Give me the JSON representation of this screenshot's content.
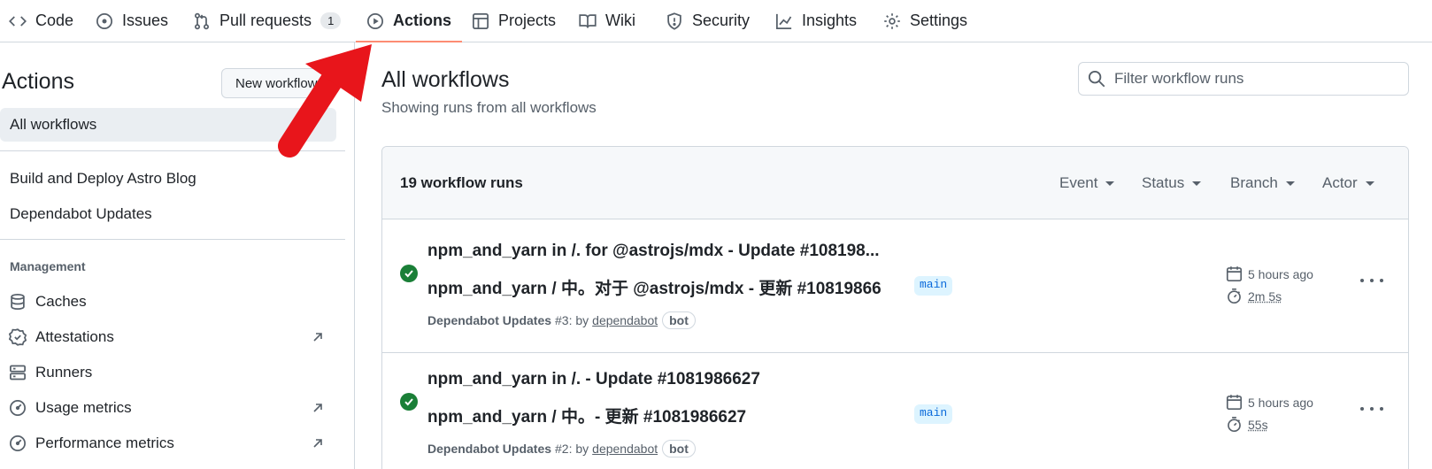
{
  "nav": {
    "tabs": [
      {
        "label": "Code",
        "icon": "code-icon"
      },
      {
        "label": "Issues",
        "icon": "issue-icon"
      },
      {
        "label": "Pull requests",
        "icon": "pull-request-icon",
        "counter": "1"
      },
      {
        "label": "Actions",
        "icon": "play-icon",
        "active": true
      },
      {
        "label": "Projects",
        "icon": "table-icon"
      },
      {
        "label": "Wiki",
        "icon": "book-icon"
      },
      {
        "label": "Security",
        "icon": "shield-icon"
      },
      {
        "label": "Insights",
        "icon": "graph-icon"
      },
      {
        "label": "Settings",
        "icon": "gear-icon"
      }
    ]
  },
  "sidebar": {
    "title": "Actions",
    "new_workflow_label": "New workflow",
    "all_workflows_label": "All workflows",
    "workflows": [
      "Build and Deploy Astro Blog",
      "Dependabot Updates"
    ],
    "management_heading": "Management",
    "management_items": [
      {
        "label": "Caches",
        "icon": "database-icon",
        "external": false
      },
      {
        "label": "Attestations",
        "icon": "verified-icon",
        "external": true
      },
      {
        "label": "Runners",
        "icon": "server-icon",
        "external": false
      },
      {
        "label": "Usage metrics",
        "icon": "meter-icon",
        "external": true
      },
      {
        "label": "Performance metrics",
        "icon": "meter-icon",
        "external": true
      }
    ]
  },
  "main": {
    "title": "All workflows",
    "subtitle": "Showing runs from all workflows",
    "filter_placeholder": "Filter workflow runs",
    "runs_count": "19 workflow runs",
    "header_filters": [
      "Event",
      "Status",
      "Branch",
      "Actor"
    ],
    "runs": [
      {
        "title": "npm_and_yarn in /. for @astrojs/mdx - Update #108198...",
        "title_translated": "npm_and_yarn / 中。对于 @astrojs/mdx - 更新 #10819866",
        "workflow": "Dependabot Updates",
        "run_number": "#3: by",
        "actor": "dependabot",
        "bot_label": "bot",
        "branch": "main",
        "time_ago": "5 hours ago",
        "duration": "2m 5s",
        "status": "success"
      },
      {
        "title": "npm_and_yarn in /. - Update #1081986627",
        "title_translated": "npm_and_yarn / 中。- 更新 #1081986627",
        "workflow": "Dependabot Updates",
        "run_number": "#2: by",
        "actor": "dependabot",
        "bot_label": "bot",
        "branch": "main",
        "time_ago": "5 hours ago",
        "duration": "55s",
        "status": "success"
      }
    ]
  },
  "colors": {
    "accent_underline": "#fd8c73",
    "success": "#1a7f37",
    "branch_bg": "#ddf4ff",
    "branch_fg": "#0969da",
    "annotation_arrow": "#e8151b"
  }
}
